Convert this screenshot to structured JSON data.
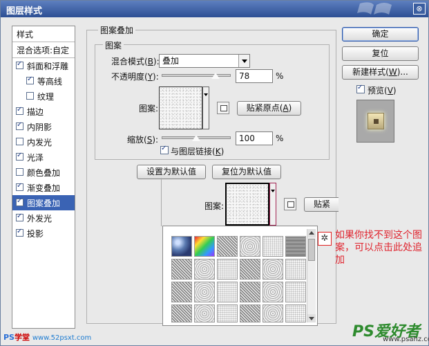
{
  "window": {
    "title": "图层样式",
    "close_glyph": "⊗"
  },
  "style_list": {
    "header": "样式",
    "blend_options": "混合选项:自定",
    "items": [
      {
        "label": "斜面和浮雕",
        "checked": true,
        "sub": false,
        "selected": false
      },
      {
        "label": "等高线",
        "checked": true,
        "sub": true,
        "selected": false
      },
      {
        "label": "纹理",
        "checked": false,
        "sub": true,
        "selected": false
      },
      {
        "label": "描边",
        "checked": true,
        "sub": false,
        "selected": false
      },
      {
        "label": "内阴影",
        "checked": true,
        "sub": false,
        "selected": false
      },
      {
        "label": "内发光",
        "checked": false,
        "sub": false,
        "selected": false
      },
      {
        "label": "光泽",
        "checked": true,
        "sub": false,
        "selected": false
      },
      {
        "label": "颜色叠加",
        "checked": false,
        "sub": false,
        "selected": false
      },
      {
        "label": "渐变叠加",
        "checked": true,
        "sub": false,
        "selected": false
      },
      {
        "label": "图案叠加",
        "checked": true,
        "sub": false,
        "selected": true
      },
      {
        "label": "外发光",
        "checked": true,
        "sub": false,
        "selected": false
      },
      {
        "label": "投影",
        "checked": true,
        "sub": false,
        "selected": false
      }
    ]
  },
  "pattern_overlay": {
    "group_title": "图案叠加",
    "subgroup_title": "图案",
    "blend_mode_label": "混合模式(",
    "blend_mode_key": "B",
    "blend_mode_value": "叠加",
    "opacity_label": "不透明度(",
    "opacity_key": "Y",
    "opacity_value": "78",
    "opacity_fraction": 0.78,
    "percent": "%",
    "pattern_label": "图案:",
    "snap_button": "贴紧原点(",
    "snap_key": "A",
    "scale_label": "缩放(",
    "scale_key": "S",
    "scale_value": "100",
    "scale_fraction": 0.5,
    "link_label": "与图层链接(",
    "link_key": "K",
    "link_checked": true,
    "set_default_button": "设置为默认值",
    "reset_default_button": "复位为默认值"
  },
  "popup": {
    "pattern_label": "图案:",
    "snap_partial": "贴紧"
  },
  "buttons": {
    "ok": "确定",
    "reset": "复位",
    "new_style": "新建样式(",
    "new_style_key": "W",
    "preview_label": "预览(",
    "preview_key": "V",
    "preview_checked": true
  },
  "annotation": {
    "text": "如果你找不到这个图案，可以点击此处追加",
    "color": "#e0242e"
  },
  "watermarks": {
    "left_ps": "PS",
    "left_cn": "学堂",
    "left_url": "www.52psxt.com",
    "right_logo": "PS爱好者",
    "right_site": "www.psahz.com"
  }
}
